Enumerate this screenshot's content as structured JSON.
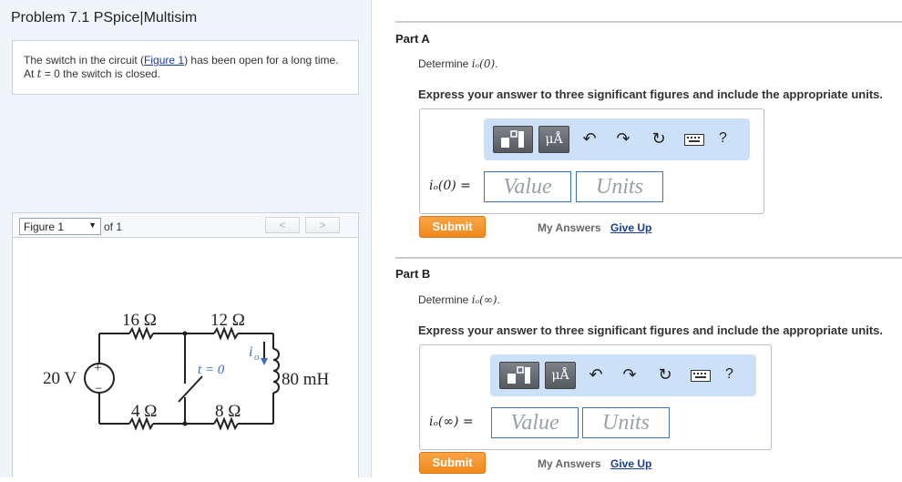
{
  "problem": {
    "title": "Problem 7.1 PSpice|Multisim",
    "statement_before_link": "The switch in the circuit (",
    "figure_link": "Figure 1",
    "statement_after_link": ") has been open for a long time. At ",
    "time_var": "t",
    "statement_end": " = 0 the switch is closed."
  },
  "figure_nav": {
    "selected": "Figure 1",
    "of_label": "of 1",
    "prev": "<",
    "next": ">"
  },
  "circuit": {
    "source": "20 V",
    "plus": "+",
    "minus": "−",
    "r1": "16 Ω",
    "r2": "12 Ω",
    "r3": "4 Ω",
    "r4": "8 Ω",
    "switch_label": "t = 0",
    "current_label": "i",
    "current_sub": "o",
    "inductor": "80 mH"
  },
  "toolbar": {
    "templates": "templates-icon",
    "units": "μÅ",
    "undo": "↶",
    "redo": "↷",
    "reset": "↻",
    "keyboard": "keyboard-icon",
    "help": "?"
  },
  "partA": {
    "label": "Part A",
    "determine": "Determine",
    "quantity": "iₒ(0)",
    "express": "Express your answer to three significant figures and include the appropriate units.",
    "eq_label": "iₒ(0) =",
    "value_placeholder": "Value",
    "units_placeholder": "Units",
    "submit": "Submit",
    "my_answers": "My Answers",
    "give_up": "Give Up"
  },
  "partB": {
    "label": "Part B",
    "determine": "Determine",
    "quantity": "iₒ(∞)",
    "express": "Express your answer to three significant figures and include the appropriate units.",
    "eq_label": "iₒ(∞) =",
    "value_placeholder": "Value",
    "units_placeholder": "Units",
    "submit": "Submit",
    "my_answers": "My Answers",
    "give_up": "Give Up"
  }
}
